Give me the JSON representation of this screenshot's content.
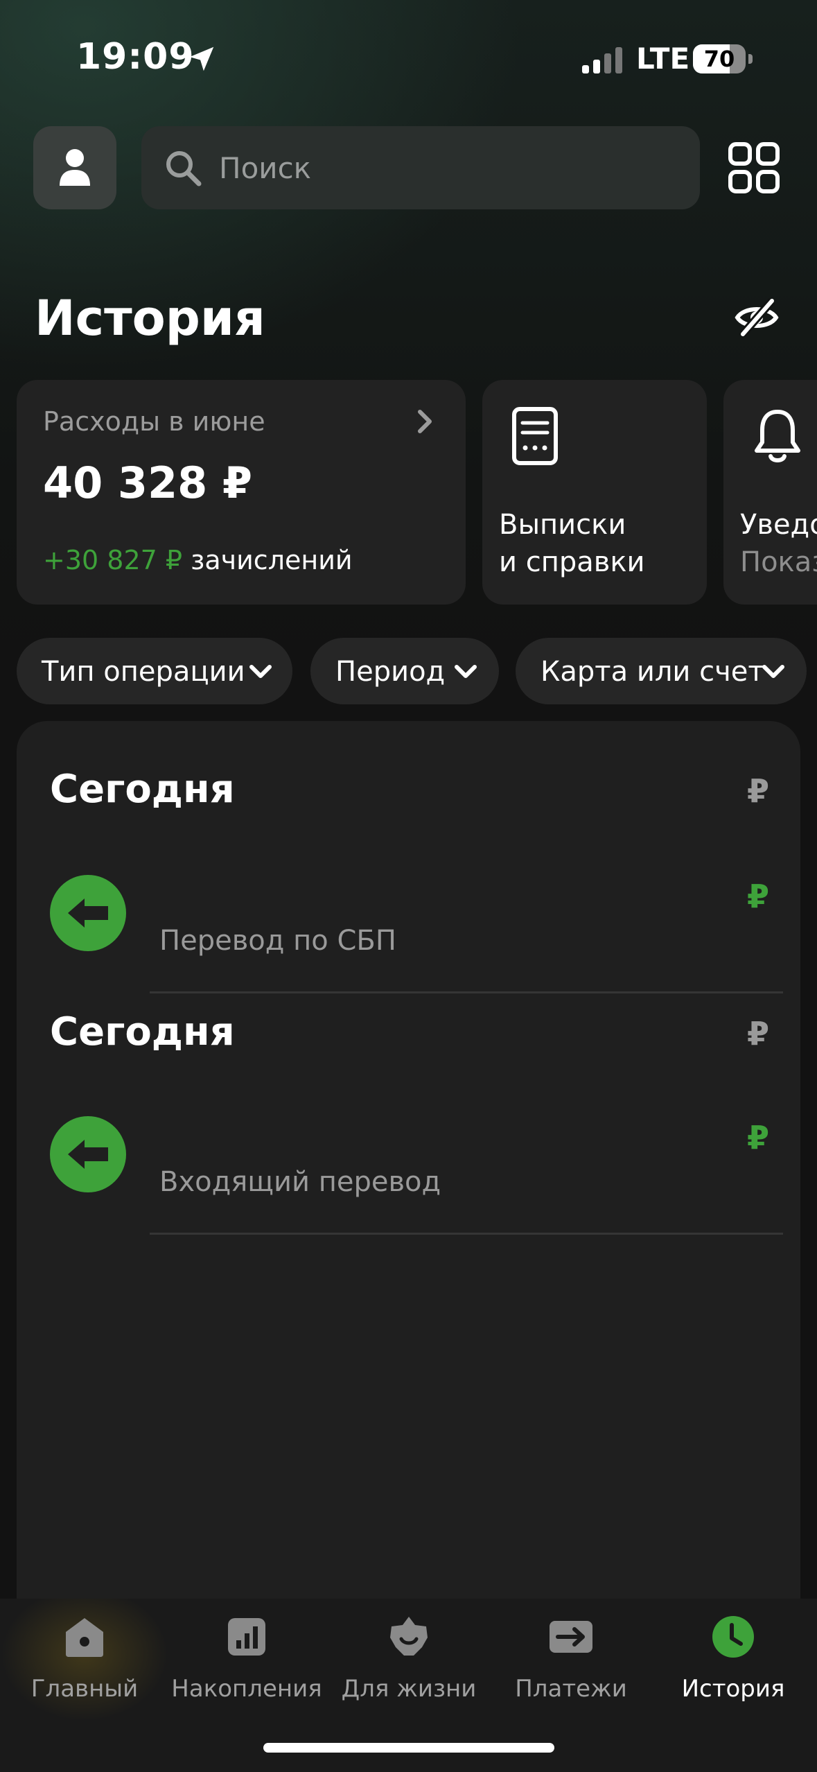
{
  "status_bar": {
    "time": "19:09",
    "network": "LTE",
    "battery": "70",
    "battery_level": 0.7
  },
  "search": {
    "placeholder": "Поиск"
  },
  "header": {
    "title": "История"
  },
  "expenses_card": {
    "label": "Расходы в июне",
    "amount": "40 328 ₽",
    "income_amount": "+30 827 ₽",
    "income_label": "зачислений"
  },
  "statements_card": {
    "line1": "Выписки",
    "line2": "и справки"
  },
  "notify_card": {
    "line1": "Уведо",
    "line2": "Показ"
  },
  "filters": [
    {
      "label": "Тип операции"
    },
    {
      "label": "Период"
    },
    {
      "label": "Карта или счет"
    }
  ],
  "operations": {
    "groups": [
      {
        "date": "Сегодня",
        "total_currency": "₽",
        "items": [
          {
            "currency": "₽",
            "description": "Перевод по СБП"
          }
        ]
      },
      {
        "date": "Сегодня",
        "total_currency": "₽",
        "items": [
          {
            "currency": "₽",
            "description": "Входящий перевод"
          }
        ]
      }
    ]
  },
  "bottom_nav": [
    {
      "label": "Главный",
      "icon": "home-icon"
    },
    {
      "label": "Накопления",
      "icon": "savings-chart-icon"
    },
    {
      "label": "Для жизни",
      "icon": "lifestyle-star-icon"
    },
    {
      "label": "Платежи",
      "icon": "payments-arrow-icon"
    },
    {
      "label": "История",
      "icon": "history-clock-icon",
      "active": true
    }
  ],
  "colors": {
    "accent_green": "#3ea23a",
    "background": "#121212",
    "card": "#222222"
  }
}
